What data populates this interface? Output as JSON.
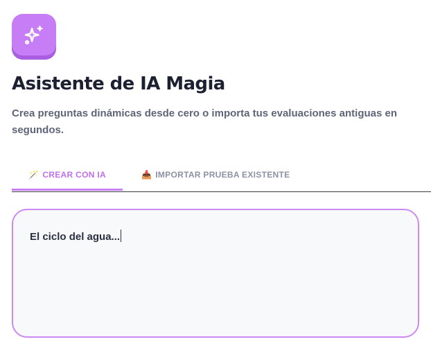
{
  "header": {
    "logo_icon": "sparkles-icon",
    "title": "Asistente de IA Magia",
    "subtitle": "Crea preguntas dinámicas desde cero o importa tus evaluaciones antiguas en segundos."
  },
  "tabs": [
    {
      "icon": "magic-wand-icon",
      "icon_glyph": "🪄",
      "label": "CREAR CON IA",
      "active": true
    },
    {
      "icon": "inbox-tray-icon",
      "icon_glyph": "📥",
      "label": "IMPORTAR PRUEBA EXISTENTE",
      "active": false
    }
  ],
  "topic_input": {
    "value": "El ciclo del agua..."
  },
  "colors": {
    "accent": "#c77df5",
    "accent_text": "#c070ee",
    "title": "#1c2030",
    "subtitle": "#5d6577",
    "inactive_tab": "#8b92a3",
    "input_border": "#cd88f2",
    "input_bg": "#f8f9fb"
  }
}
